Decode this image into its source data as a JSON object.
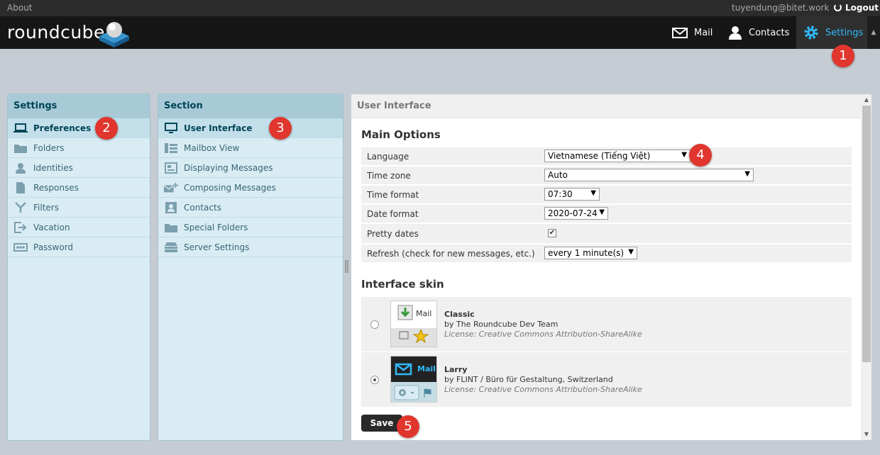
{
  "topbar": {
    "about": "About",
    "user": "tuyendung@bitet.work",
    "logout": "Logout"
  },
  "header": {
    "logo": "roundcube"
  },
  "nav": {
    "mail": "Mail",
    "contacts": "Contacts",
    "settings": "Settings"
  },
  "badges": {
    "b1": "1",
    "b2": "2",
    "b3": "3",
    "b4": "4",
    "b5": "5"
  },
  "settings_panel": {
    "title": "Settings",
    "items": [
      {
        "label": "Preferences"
      },
      {
        "label": "Folders"
      },
      {
        "label": "Identities"
      },
      {
        "label": "Responses"
      },
      {
        "label": "Filters"
      },
      {
        "label": "Vacation"
      },
      {
        "label": "Password"
      }
    ]
  },
  "section_panel": {
    "title": "Section",
    "items": [
      {
        "label": "User Interface"
      },
      {
        "label": "Mailbox View"
      },
      {
        "label": "Displaying Messages"
      },
      {
        "label": "Composing Messages"
      },
      {
        "label": "Contacts"
      },
      {
        "label": "Special Folders"
      },
      {
        "label": "Server Settings"
      }
    ]
  },
  "content": {
    "title": "User Interface",
    "main_options": "Main Options",
    "rows": {
      "language": {
        "label": "Language",
        "value": "Vietnamese (Tiếng Việt)"
      },
      "timezone": {
        "label": "Time zone",
        "value": "Auto"
      },
      "timeformat": {
        "label": "Time format",
        "value": "07:30"
      },
      "dateformat": {
        "label": "Date format",
        "value": "2020-07-24"
      },
      "prettydates": {
        "label": "Pretty dates",
        "checked": "✔"
      },
      "refresh": {
        "label": "Refresh (check for new messages, etc.)",
        "value": "every 1 minute(s)"
      }
    },
    "interface_skin": "Interface skin",
    "skins": [
      {
        "name": "Classic",
        "author": "by The Roundcube Dev Team",
        "license": "License: Creative Commons Attribution-ShareAlike",
        "thumb_label": "Mail"
      },
      {
        "name": "Larry",
        "author": "by FLINT / Büro für Gestaltung, Switzerland",
        "license": "License: Creative Commons Attribution-ShareAlike",
        "thumb_label": "Mail"
      }
    ],
    "save": "Save"
  },
  "colors": {
    "accent": "#30b8f7",
    "badge": "#e0362e",
    "panel": "#d9ecf4",
    "panel_header": "#a7cad6"
  }
}
